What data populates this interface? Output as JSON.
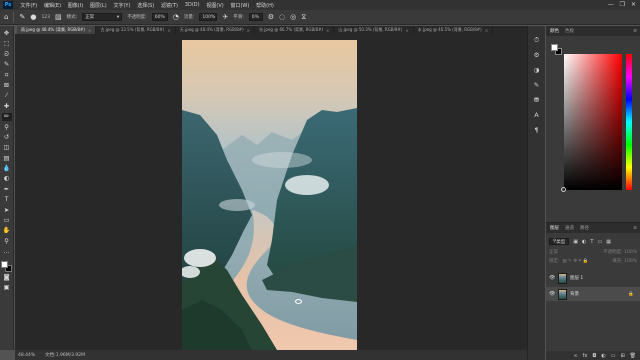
{
  "app": {
    "logo": "Ps"
  },
  "menu": [
    "文件(F)",
    "编辑(E)",
    "图像(I)",
    "图层(L)",
    "文字(Y)",
    "选择(S)",
    "滤镜(T)",
    "3D(D)",
    "视图(V)",
    "窗口(W)",
    "帮助(H)"
  ],
  "window_controls": {
    "minimize": "—",
    "restore": "❐",
    "close": "✕"
  },
  "options": {
    "brush_size": "123",
    "mode_label": "模式:",
    "mode_value": "正常",
    "opacity_label": "不透明度:",
    "opacity_value": "60%",
    "flow_label": "流量:",
    "flow_value": "100%",
    "smooth_label": "平滑:",
    "smooth_value": "0%"
  },
  "tabs": [
    {
      "label": "雨.jpeg @ 48.4% (背景, RGB/8#)",
      "close": "×"
    },
    {
      "label": "古.jpeg @ 33.5% (背景, RGB/8#)",
      "close": "×"
    },
    {
      "label": "天.jpeg @ 48.4% (背景, RGB/8#)",
      "close": "×"
    },
    {
      "label": "光.jpeg @ 66.7% (背景, RGB/8#)",
      "close": "×"
    },
    {
      "label": "山.jpeg @ 50.3% (背景, RGB/8#)",
      "close": "×"
    },
    {
      "label": "水.jpeg @ 46.5% (背景, RGB/8#)",
      "close": "×"
    }
  ],
  "status": {
    "zoom": "48.44%",
    "doc": "文档:1.96M/3.92M"
  },
  "color_panel": {
    "tab_color": "颜色",
    "tab_swatches": "色板",
    "menu": "≡"
  },
  "layers_panel": {
    "tab_layers": "图层",
    "tab_channels": "通道",
    "tab_paths": "路径",
    "menu": "≡",
    "kind_label": "类型",
    "blend": "正常",
    "opacity": "不透明度: 100%",
    "lock_label": "锁定:",
    "fill": "填充: 100%",
    "layers": [
      {
        "name": "图层 1",
        "selected": false
      },
      {
        "name": "背景",
        "selected": true
      }
    ]
  },
  "colors": {
    "accent": "#31a8ff",
    "canvas_bg": "#282828",
    "chrome": "#3a3a3a"
  }
}
